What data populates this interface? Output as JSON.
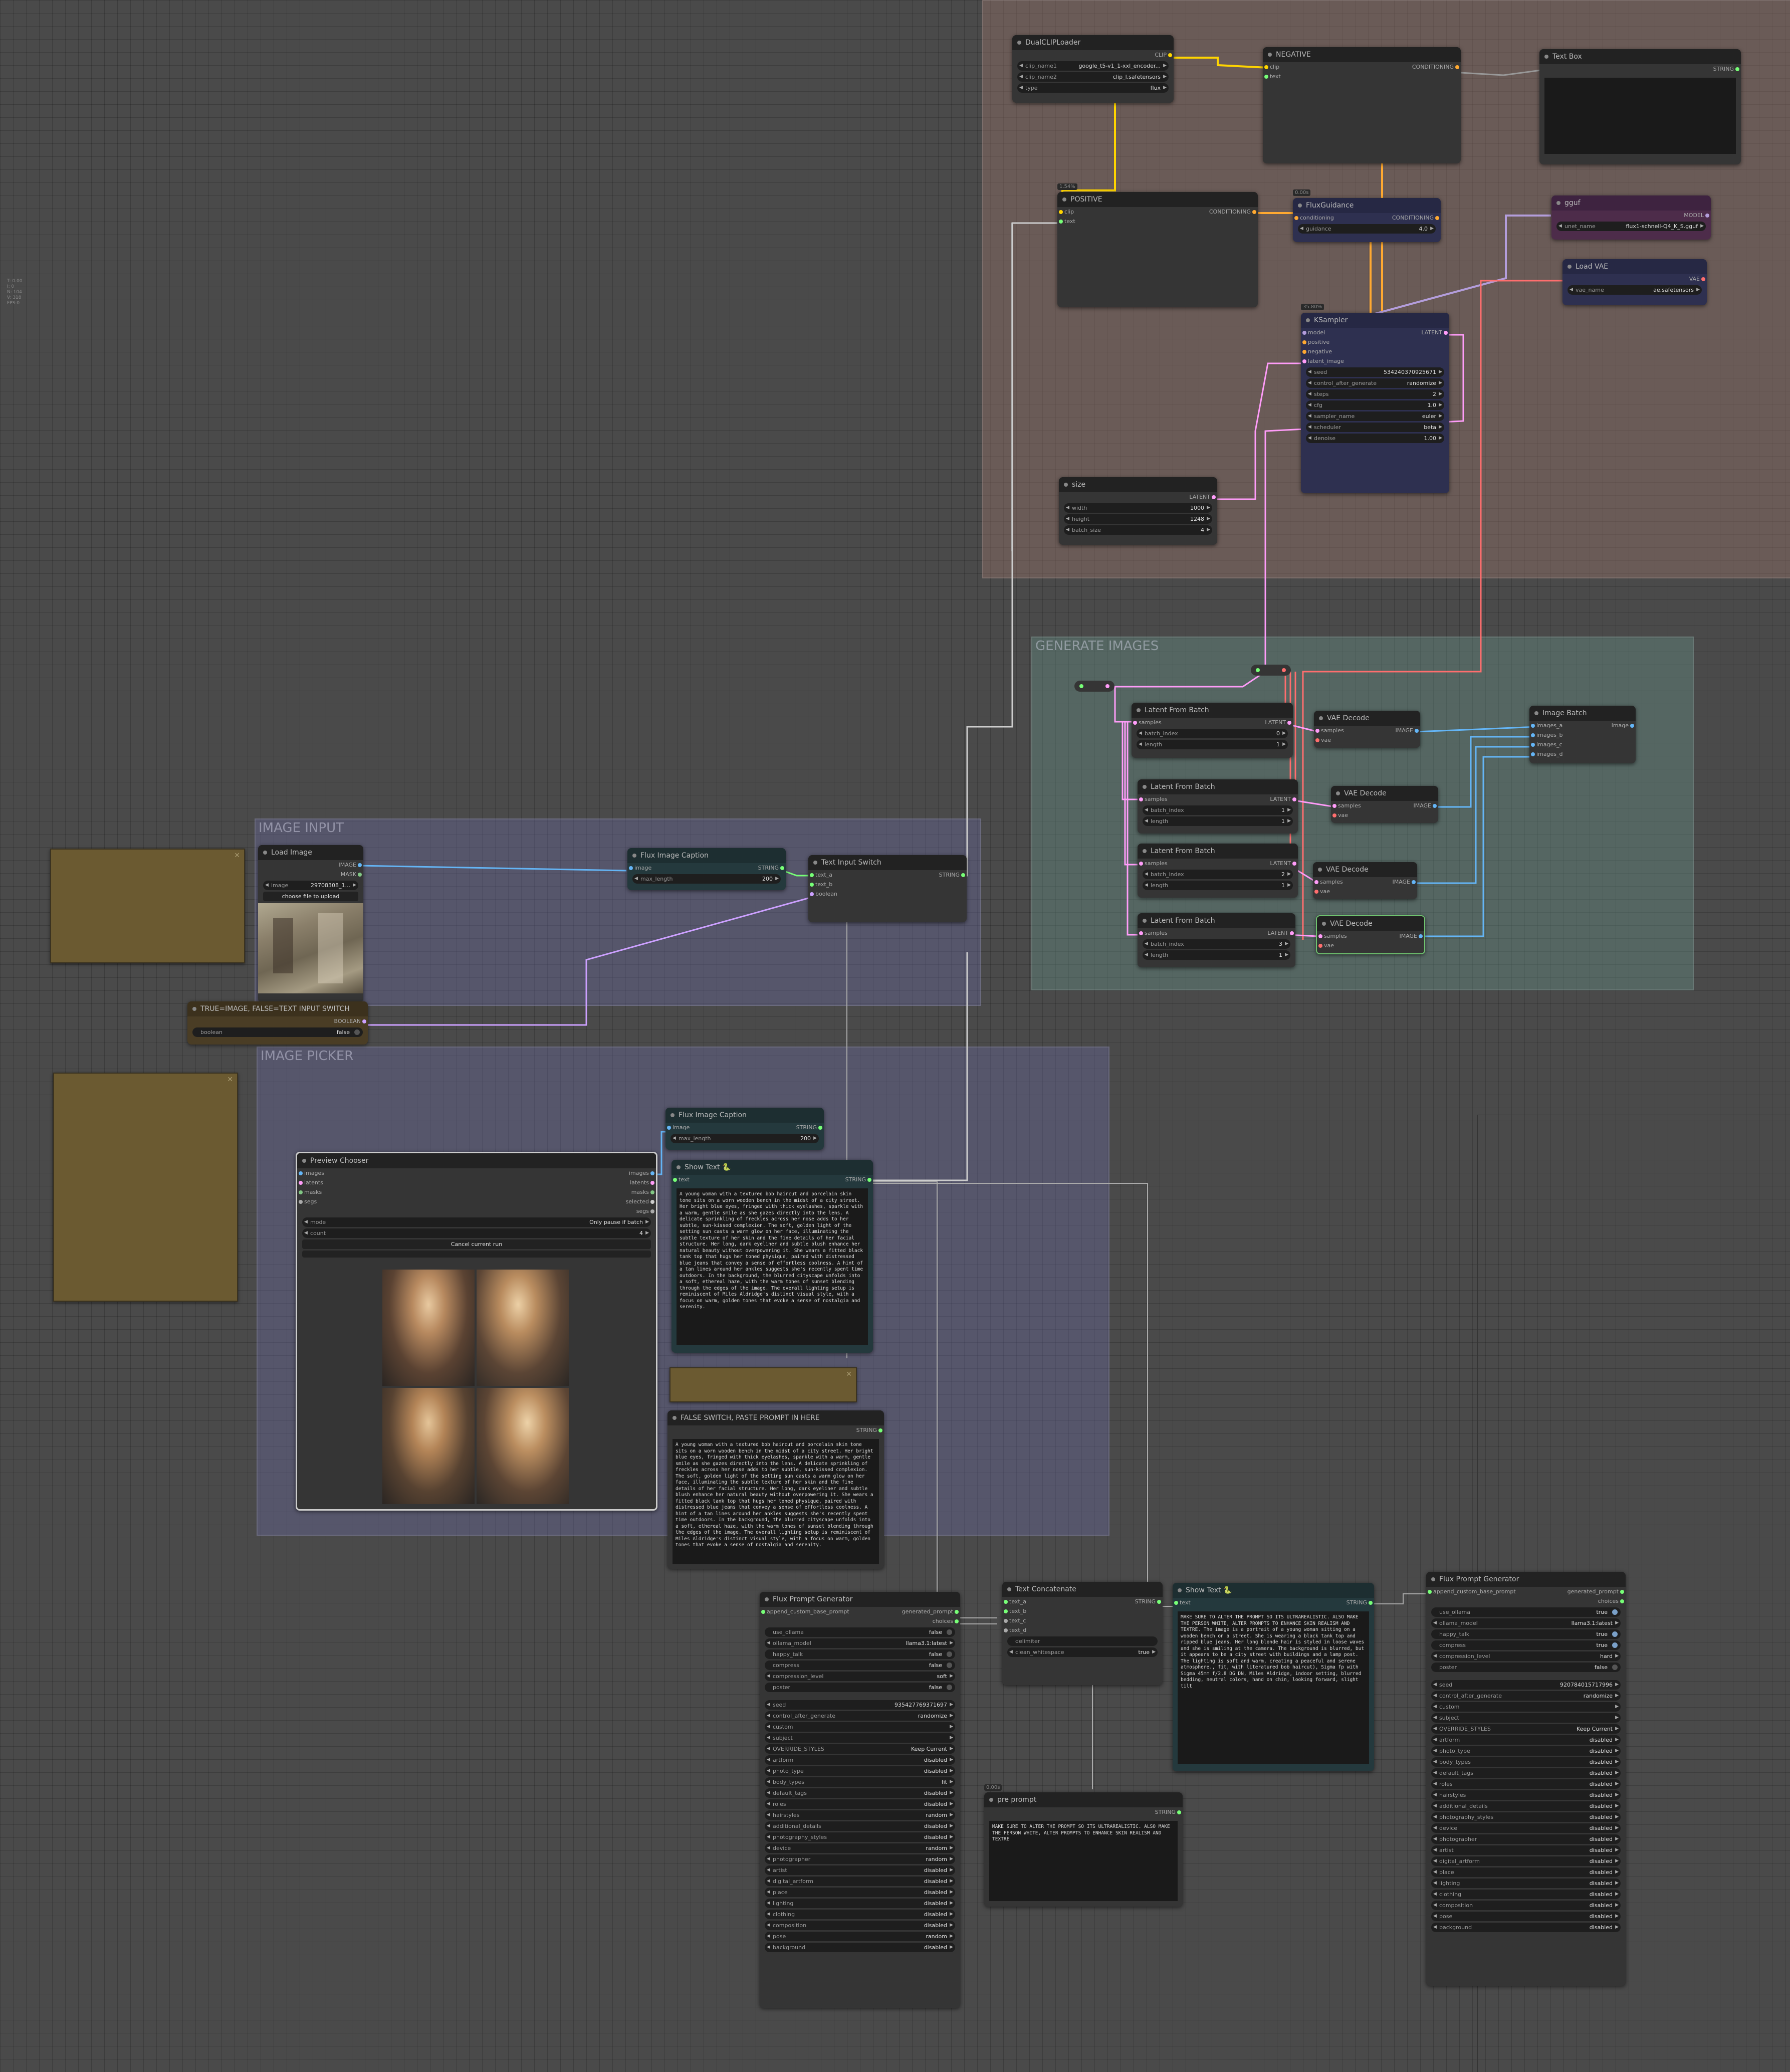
{
  "groups": {
    "generate_images": "GENERATE IMAGES",
    "image_input": "IMAGE INPUT",
    "image_picker": "IMAGE PICKER"
  },
  "side_info": [
    "T: 0.00",
    "I: 0",
    "N: 104",
    "V: 318",
    "FPS:0"
  ],
  "dual_clip": {
    "title": "DualCLIPLoader",
    "out": "CLIP",
    "clip_name1_l": "clip_name1",
    "clip_name1": "google_t5-v1_1-xxl_encoder...",
    "clip_name2_l": "clip_name2",
    "clip_name2": "clip_l.safetensors",
    "type_l": "type",
    "type": "flux"
  },
  "negative": {
    "title": "NEGATIVE",
    "in1": "clip",
    "in2": "text",
    "out": "CONDITIONING"
  },
  "textbox": {
    "title": "Text Box",
    "out": "STRING"
  },
  "positive": {
    "badge": "1.54%",
    "title": "POSITIVE",
    "in1": "clip",
    "in2": "text",
    "out": "CONDITIONING"
  },
  "fluxguidance": {
    "badge": "0.00s",
    "title": "FluxGuidance",
    "in": "conditioning",
    "out": "CONDITIONING",
    "guidance_l": "guidance",
    "guidance": "4.0"
  },
  "gguf": {
    "title": "gguf",
    "out": "MODEL",
    "unet_name_l": "unet_name",
    "unet_name": "flux1-schnell-Q4_K_S.gguf"
  },
  "loadvae": {
    "title": "Load VAE",
    "out": "VAE",
    "vae_name_l": "vae_name",
    "vae_name": "ae.safetensors"
  },
  "ksampler": {
    "badge": "35.80%",
    "title": "KSampler",
    "in": [
      "model",
      "positive",
      "negative",
      "latent_image"
    ],
    "out": "LATENT",
    "widgets": [
      [
        "seed",
        "534240370925671"
      ],
      [
        "control_after_generate",
        "randomize"
      ],
      [
        "steps",
        "2"
      ],
      [
        "cfg",
        "1.0"
      ],
      [
        "sampler_name",
        "euler"
      ],
      [
        "scheduler",
        "beta"
      ],
      [
        "denoise",
        "1.00"
      ]
    ]
  },
  "size": {
    "title": "size",
    "out": "LATENT",
    "widgets": [
      [
        "width",
        "1000"
      ],
      [
        "height",
        "1248"
      ],
      [
        "batch_size",
        "4"
      ]
    ]
  },
  "latent_batch": [
    {
      "title": "Latent From Batch",
      "in": "samples",
      "out": "LATENT",
      "batch_index": "0",
      "length": "1"
    },
    {
      "title": "Latent From Batch",
      "in": "samples",
      "out": "LATENT",
      "batch_index": "1",
      "length": "1"
    },
    {
      "title": "Latent From Batch",
      "in": "samples",
      "out": "LATENT",
      "batch_index": "2",
      "length": "1"
    },
    {
      "title": "Latent From Batch",
      "in": "samples",
      "out": "LATENT",
      "batch_index": "3",
      "length": "1"
    }
  ],
  "widget_labels": {
    "batch_index": "batch_index",
    "length": "length"
  },
  "vae_decode": {
    "title": "VAE Decode",
    "in1": "samples",
    "in2": "vae",
    "out": "IMAGE"
  },
  "image_batch": {
    "title": "Image Batch",
    "in": [
      "images_a",
      "images_b",
      "images_c",
      "images_d"
    ],
    "out": "image"
  },
  "load_image": {
    "title": "Load Image",
    "out1": "IMAGE",
    "out2": "MASK",
    "image_l": "image",
    "image": "29708308_1...",
    "upload": "choose file to upload"
  },
  "flux_caption1": {
    "title": "Flux Image Caption",
    "in": "image",
    "out": "STRING",
    "max_length_l": "max_length",
    "max_length": "200"
  },
  "text_switch": {
    "title": "Text Input Switch",
    "in": [
      "text_a",
      "text_b",
      "boolean"
    ],
    "out": "STRING"
  },
  "bool_switch": {
    "title": "TRUE=IMAGE, FALSE=TEXT INPUT SWITCH",
    "out": "BOOLEAN",
    "w_l": "boolean",
    "w": "false"
  },
  "flux_caption2": {
    "title": "Flux Image Caption",
    "in": "image",
    "out": "STRING",
    "max_length_l": "max_length",
    "max_length": "200"
  },
  "show_text1": {
    "title": "Show Text 🐍",
    "in": "text",
    "out": "STRING",
    "text": "A young woman with a textured bob haircut and porcelain skin tone sits on a worn wooden bench in the midst of a city street. Her bright blue eyes, fringed with thick eyelashes, sparkle with a warm, gentle smile as she gazes directly into the lens. A delicate sprinkling of freckles across her nose adds to her subtle, sun-kissed complexion. The soft, golden light of the setting sun casts a warm glow on her face, illuminating the subtle texture of her skin and the fine details of her facial structure. Her long, dark eyeliner and subtle blush enhance her natural beauty without overpowering it. She wears a fitted black tank top that hugs her toned physique, paired with distressed blue jeans that convey a sense of effortless coolness. A hint of a tan lines around her ankles suggests she's recently spent time outdoors. In the background, the blurred cityscape unfolds into a soft, ethereal haze, with the warm tones of sunset blending through the edges of the image. The overall lighting setup is reminiscent of Miles Aldridge's distinct visual style, with a focus on warm, golden tones that evoke a sense of nostalgia and serenity."
  },
  "preview_chooser": {
    "title": "Preview Chooser",
    "in": [
      "images",
      "latents",
      "masks",
      "segs"
    ],
    "out": [
      "images",
      "latents",
      "masks",
      "selected",
      "segs"
    ],
    "mode_l": "mode",
    "mode": "Only pause if batch",
    "count_l": "count",
    "count": "4",
    "cancel": "Cancel current run"
  },
  "false_switch": {
    "title": "FALSE SWITCH, PASTE PROMPT IN HERE",
    "out": "STRING",
    "text": "A young woman with a textured bob haircut and porcelain skin tone sits on a worn wooden bench in the midst of a city street. Her bright blue eyes, fringed with thick eyelashes, sparkle with a warm, gentle smile as she gazes directly into the lens. A delicate sprinkling of freckles across her nose adds to her subtle, sun-kissed complexion. The soft, golden light of the setting sun casts a warm glow on her face, illuminating the subtle texture of her skin and the fine details of her facial structure. Her long, dark eyeliner and subtle blush enhance her natural beauty without overpowering it. She wears a fitted black tank top that hugs her toned physique, paired with distressed blue jeans that convey a sense of effortless coolness. A hint of a tan lines around her ankles suggests she's recently spent time outdoors. In the background, the blurred cityscape unfolds into a soft, ethereal haze, with the warm tones of sunset blending through the edges of the image. The overall lighting setup is reminiscent of Miles Aldridge's distinct visual style, with a focus on warm, golden tones that evoke a sense of nostalgia and serenity."
  },
  "fpg1": {
    "title": "Flux Prompt Generator",
    "in": "append_custom_base_prompt",
    "out1": "generated_prompt",
    "out2": "choices",
    "top": [
      [
        "use_ollama",
        "false",
        "t"
      ],
      [
        "ollama_model",
        "llama3.1:latest",
        "w"
      ],
      [
        "happy_talk",
        "false",
        "t"
      ],
      [
        "compress",
        "false",
        "t"
      ],
      [
        "compression_level",
        "soft",
        "w"
      ],
      [
        "poster",
        "false",
        "t"
      ]
    ],
    "bottom": [
      [
        "seed",
        "935427769371697"
      ],
      [
        "control_after_generate",
        "randomize"
      ],
      [
        "custom",
        ""
      ],
      [
        "subject",
        ""
      ],
      [
        "OVERRIDE_STYLES",
        "Keep Current"
      ],
      [
        "artform",
        "disabled"
      ],
      [
        "photo_type",
        "disabled"
      ],
      [
        "body_types",
        "fit"
      ],
      [
        "default_tags",
        "disabled"
      ],
      [
        "roles",
        "disabled"
      ],
      [
        "hairstyles",
        "random"
      ],
      [
        "additional_details",
        "disabled"
      ],
      [
        "photography_styles",
        "disabled"
      ],
      [
        "device",
        "random"
      ],
      [
        "photographer",
        "random"
      ],
      [
        "artist",
        "disabled"
      ],
      [
        "digital_artform",
        "disabled"
      ],
      [
        "place",
        "disabled"
      ],
      [
        "lighting",
        "disabled"
      ],
      [
        "clothing",
        "disabled"
      ],
      [
        "composition",
        "disabled"
      ],
      [
        "pose",
        "random"
      ],
      [
        "background",
        "disabled"
      ]
    ]
  },
  "text_concat": {
    "title": "Text Concatenate",
    "in": [
      "text_a",
      "text_b",
      "text_c",
      "text_d"
    ],
    "out": "STRING",
    "delim_l": "delimiter",
    "delim": "",
    "clean_l": "clean_whitespace",
    "clean": "true"
  },
  "show_text2": {
    "title": "Show Text 🐍",
    "in": "text",
    "out": "STRING",
    "text": "MAKE SURE TO ALTER THE PROMPT SO ITS ULTRAREALISTIC. ALSO MAKE THE PERSON WHITE, ALTER PROMPTS TO ENHANCE SKIN REALISM AND TEXTRE. The image is a portrait of a young woman sitting on a wooden bench on a street. She is wearing a black tank top and ripped blue jeans. Her long blonde hair is styled in loose waves and she is smiling at the camera. The background is blurred, but it appears to be a city street with buildings and a lamp post. The lighting is soft and warm, creating a peaceful and serene atmosphere., fit, with literatured bob haircut), Sigma fp with Sigma 45mm f/2.8 DG DN, Miles Aldridge, indoor setting, blurred bedding, neutral colors, hand on chin, looking forward, slight tilt"
  },
  "pre_prompt": {
    "badge": "0.00s",
    "title": "pre prompt",
    "out": "STRING",
    "text": "MAKE SURE TO ALTER THE PROMPT SO ITS ULTRAREALISTIC. ALSO MAKE THE PERSON WHITE, ALTER PROMPTS TO ENHANCE SKIN REALISM AND TEXTRE"
  },
  "fpg2": {
    "title": "Flux Prompt Generator",
    "in": "append_custom_base_prompt",
    "out1": "generated_prompt",
    "out2": "choices",
    "top": [
      [
        "use_ollama",
        "true",
        "t"
      ],
      [
        "ollama_model",
        "llama3.1:latest",
        "w"
      ],
      [
        "happy_talk",
        "true",
        "t"
      ],
      [
        "compress",
        "true",
        "t"
      ],
      [
        "compression_level",
        "hard",
        "w"
      ],
      [
        "poster",
        "false",
        "t"
      ]
    ],
    "bottom": [
      [
        "seed",
        "920784015717996"
      ],
      [
        "control_after_generate",
        "randomize"
      ],
      [
        "custom",
        ""
      ],
      [
        "subject",
        ""
      ],
      [
        "OVERRIDE_STYLES",
        "Keep Current"
      ],
      [
        "artform",
        "disabled"
      ],
      [
        "photo_type",
        "disabled"
      ],
      [
        "body_types",
        "disabled"
      ],
      [
        "default_tags",
        "disabled"
      ],
      [
        "roles",
        "disabled"
      ],
      [
        "hairstyles",
        "disabled"
      ],
      [
        "additional_details",
        "disabled"
      ],
      [
        "photography_styles",
        "disabled"
      ],
      [
        "device",
        "disabled"
      ],
      [
        "photographer",
        "disabled"
      ],
      [
        "artist",
        "disabled"
      ],
      [
        "digital_artform",
        "disabled"
      ],
      [
        "place",
        "disabled"
      ],
      [
        "lighting",
        "disabled"
      ],
      [
        "clothing",
        "disabled"
      ],
      [
        "composition",
        "disabled"
      ],
      [
        "pose",
        "disabled"
      ],
      [
        "background",
        "disabled"
      ]
    ]
  },
  "colors": {
    "clip": "#ffd500",
    "cond": "#ffa931",
    "model": "#b39ddb",
    "latent": "#ff9cf9",
    "vae": "#ff6e6e",
    "image": "#64b5f6",
    "string": "#77ff77",
    "bool": "#cca0ff",
    "mask": "#81c784"
  }
}
